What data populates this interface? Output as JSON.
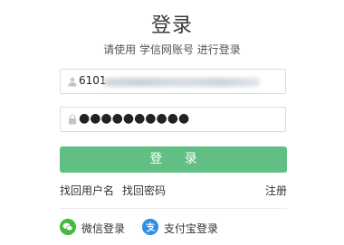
{
  "header": {
    "title": "登录",
    "subtitle": "请使用 学信网账号 进行登录"
  },
  "form": {
    "username_value": "6101",
    "username_icon": "user-icon",
    "password_mask": "●●●●●●●●●●",
    "password_icon": "lock-icon",
    "login_label": "登 录"
  },
  "links": {
    "forgot_username": "找回用户名",
    "forgot_password": "找回密码",
    "register": "注册"
  },
  "social": {
    "wechat_label": "微信登录",
    "wechat_icon": "wechat-icon",
    "alipay_label": "支付宝登录",
    "alipay_icon": "alipay-icon"
  },
  "colors": {
    "button": "#62bf84",
    "wechat": "#46b942",
    "alipay": "#2d8fe8"
  }
}
